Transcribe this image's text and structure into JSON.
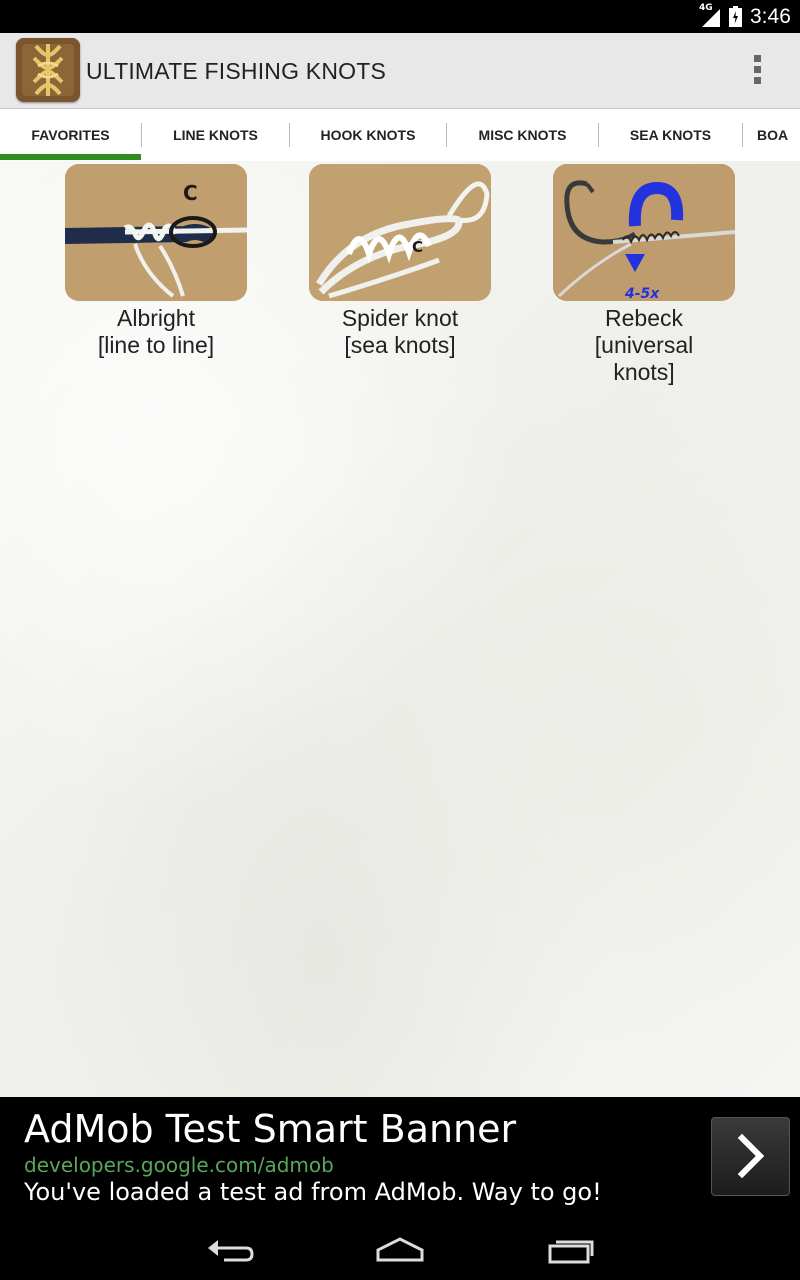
{
  "status_bar": {
    "network": "4G",
    "time": "3:46",
    "icons": [
      "signal-icon",
      "battery-icon"
    ]
  },
  "action_bar": {
    "title": "ULTIMATE FISHING KNOTS",
    "icons": [
      "app-logo-icon",
      "overflow-menu-icon"
    ]
  },
  "tabs": [
    {
      "label": "FAVORITES",
      "selected": true
    },
    {
      "label": "LINE KNOTS",
      "selected": false
    },
    {
      "label": "HOOK KNOTS",
      "selected": false
    },
    {
      "label": "MISC KNOTS",
      "selected": false
    },
    {
      "label": "SEA KNOTS",
      "selected": false
    },
    {
      "label": "BOA",
      "selected": false
    }
  ],
  "favorites": [
    {
      "name": "Albright",
      "category": "[line to line]",
      "image_overlay": "C"
    },
    {
      "name": "Spider knot",
      "category": "[sea knots]",
      "image_overlay": "C"
    },
    {
      "name": "Rebeck",
      "category_line1": "[universal",
      "category_line2": "knots]",
      "image_overlay": "4-5x"
    }
  ],
  "ad": {
    "title": "AdMob Test Smart Banner",
    "url": "developers.google.com/admob",
    "text": "You've loaded a test ad from AdMob. Way to go!",
    "button_icon": "chevron-right-icon"
  },
  "nav_bar": {
    "icons": [
      "back-icon",
      "home-icon",
      "recents-icon"
    ]
  },
  "colors": {
    "tab_indicator": "#2e8b1e",
    "ad_url": "#5aa65a",
    "action_bar": "#e8e8e8"
  }
}
